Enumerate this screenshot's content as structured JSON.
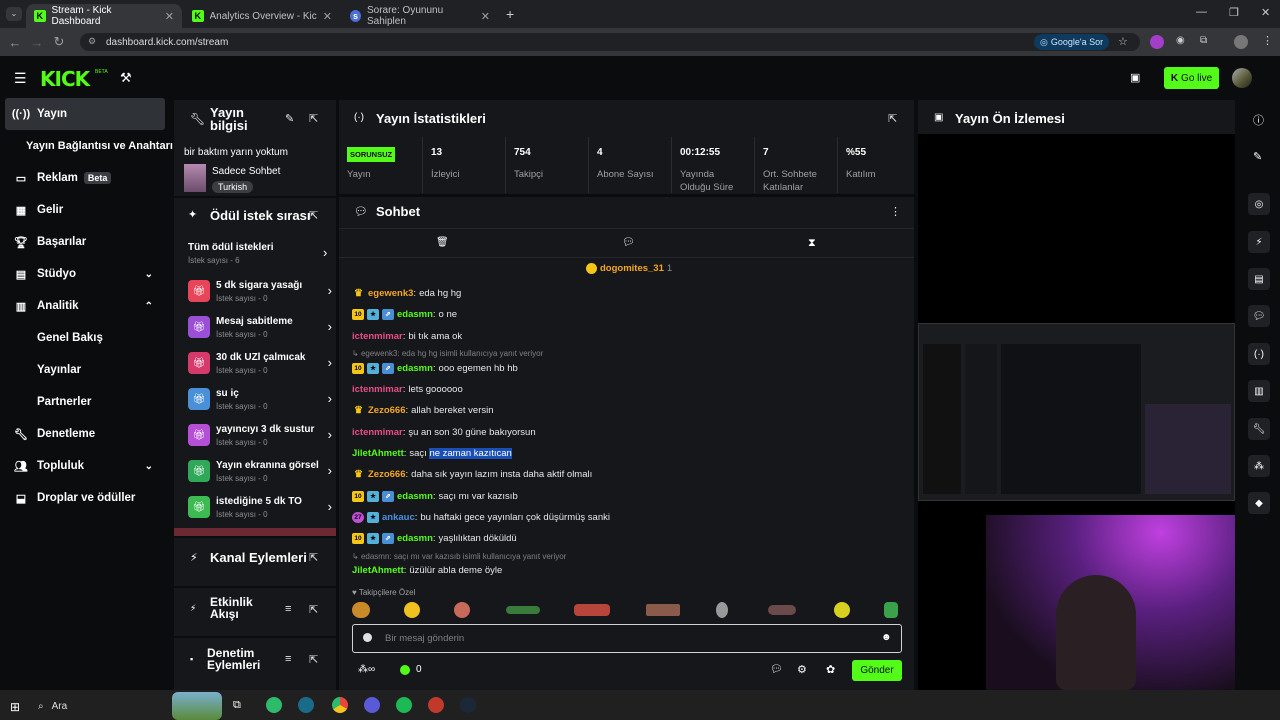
{
  "browser": {
    "tabs": [
      {
        "title": "Stream - Kick Dashboard",
        "active": true
      },
      {
        "title": "Analytics Overview - Kick Dashb",
        "active": false
      },
      {
        "title": "Sorare: Oyununu Sahiplen",
        "active": false
      }
    ],
    "url": "dashboard.kick.com/stream",
    "google_sor": "Google'a Sor"
  },
  "header": {
    "logo": "KICK",
    "logo_beta": "BETA",
    "go_live": "Go live"
  },
  "nav": [
    {
      "label": "Yayın",
      "icon": "broadcast-icon",
      "selected": true
    },
    {
      "label": "Yayın Bağlantısı ve Anahtarı",
      "sub": true
    },
    {
      "label": "Reklam",
      "icon": "ad-icon",
      "badge": "Beta"
    },
    {
      "label": "Gelir",
      "icon": "revenue-icon"
    },
    {
      "label": "Başarılar",
      "icon": "trophy-icon"
    },
    {
      "label": "Stüdyo",
      "icon": "studio-icon",
      "chevron": "down"
    },
    {
      "label": "Analitik",
      "icon": "analytics-icon",
      "chevron": "up"
    },
    {
      "label": "Genel Bakış",
      "sub": true
    },
    {
      "label": "Yayınlar",
      "sub": true
    },
    {
      "label": "Partnerler",
      "sub": true
    },
    {
      "label": "Denetleme",
      "icon": "moderation-icon"
    },
    {
      "label": "Topluluk",
      "icon": "community-icon",
      "chevron": "down"
    },
    {
      "label": "Droplar ve ödüller",
      "icon": "drops-icon"
    }
  ],
  "stream_info": {
    "title": "Yayın bilgisi",
    "stream_title": "bir baktım yarın yoktum",
    "category": "Sadece Sohbet",
    "language": "Turkish"
  },
  "rewards": {
    "title": "Ödül istek sırası",
    "all_label": "Tüm ödül istekleri",
    "all_count": "İstek sayısı - 6",
    "items": [
      {
        "label": "5 dk sigara yasağı",
        "count": "İstek sayısı - 0",
        "color": "#e8455a"
      },
      {
        "label": "Mesaj sabitleme",
        "count": "İstek sayısı - 0",
        "color": "#9b4fd6"
      },
      {
        "label": "30 dk UZİ çalmıcak",
        "count": "İstek sayısı - 0",
        "color": "#d63a6a"
      },
      {
        "label": "su iç",
        "count": "İstek sayısı - 0",
        "color": "#4a90d9"
      },
      {
        "label": "yayıncıyı 3 dk sustur",
        "count": "İstek sayısı - 0",
        "color": "#b44fd6"
      },
      {
        "label": "Yayın ekranına görsel",
        "count": "İstek sayısı - 0",
        "color": "#2fa85a"
      },
      {
        "label": "istediğine 5 dk TO",
        "count": "İstek sayısı - 0",
        "color": "#3dbb52"
      }
    ]
  },
  "panels": {
    "channel_actions": "Kanal Eylemleri",
    "activity_feed": "Etkinlik Akışı",
    "mod_actions": "Denetim Eylemleri",
    "stats_title": "Yayın İstatistikleri",
    "preview_title": "Yayın Ön İzlemesi",
    "chat_title": "Sohbet"
  },
  "stats": [
    {
      "value": "SORUNSUZ",
      "label": "Yayın",
      "is_badge": true
    },
    {
      "value": "13",
      "label": "İzleyici"
    },
    {
      "value": "754",
      "label": "Takipçi"
    },
    {
      "value": "4",
      "label": "Abone Sayısı"
    },
    {
      "value": "00:12:55",
      "label": "Yayında Olduğu Süre"
    },
    {
      "value": "7",
      "label": "Ort. Sohbete Katılanlar"
    },
    {
      "value": "%55",
      "label": "Katılım"
    }
  ],
  "chat": {
    "pinned_user": "dogomites_31",
    "pinned_count": "1",
    "messages": [
      {
        "user": "egewenk3",
        "color": "#f5a623",
        "badges": [
          "crown"
        ],
        "text": "eda hg hg"
      },
      {
        "user": "edasmn",
        "color": "#53fc18",
        "badges": [
          "10",
          "sub",
          "gift"
        ],
        "text": "o ne"
      },
      {
        "user": "ictenmimar",
        "color": "#e84c8a",
        "badges": [],
        "text": "bi tık ama ok"
      },
      {
        "reply": "egewenk3: eda hg hg isimli kullanıcıya yanıt veriyor"
      },
      {
        "user": "edasmn",
        "color": "#53fc18",
        "badges": [
          "10",
          "sub",
          "gift"
        ],
        "text": "ooo egemen hb hb"
      },
      {
        "user": "ictenmimar",
        "color": "#e84c8a",
        "badges": [],
        "text": "lets goooooo"
      },
      {
        "user": "Zezo666",
        "color": "#f5a623",
        "badges": [
          "crown"
        ],
        "text": "allah bereket versin"
      },
      {
        "user": "ictenmimar",
        "color": "#e84c8a",
        "badges": [],
        "text": "şu an son 30 güne bakıyorsun"
      },
      {
        "user": "JiletAhmett",
        "color": "#53fc18",
        "badges": [],
        "text": "saçı ne zaman kazıtıcan"
      },
      {
        "user": "Zezo666",
        "color": "#f5a623",
        "badges": [
          "crown"
        ],
        "text": "daha sık yayın lazım insta daha aktif olmalı"
      },
      {
        "user": "edasmn",
        "color": "#53fc18",
        "badges": [
          "10",
          "sub",
          "gift"
        ],
        "text": "saçı mı var kazısıb"
      },
      {
        "user": "ankauc",
        "color": "#4a90e2",
        "badges": [
          "27",
          "sub"
        ],
        "text": "bu haftaki gece yayınları çok düşürmüş sanki"
      },
      {
        "user": "edasmn",
        "color": "#53fc18",
        "badges": [
          "10",
          "sub",
          "gift"
        ],
        "text": "yaşlılıktan döküldü"
      },
      {
        "reply": "edasmn: saçı mı var kazısıb isimli kullanıcıya yanıt veriyor"
      },
      {
        "user": "JiletAhmett",
        "color": "#53fc18",
        "badges": [],
        "text": "üzülür abla deme öyle"
      }
    ],
    "emote_header": "Takipçilere Özel",
    "input_placeholder": "Bir mesaj gönderin",
    "points": "0",
    "send": "Gönder"
  },
  "taskbar": {
    "search": "Ara"
  }
}
